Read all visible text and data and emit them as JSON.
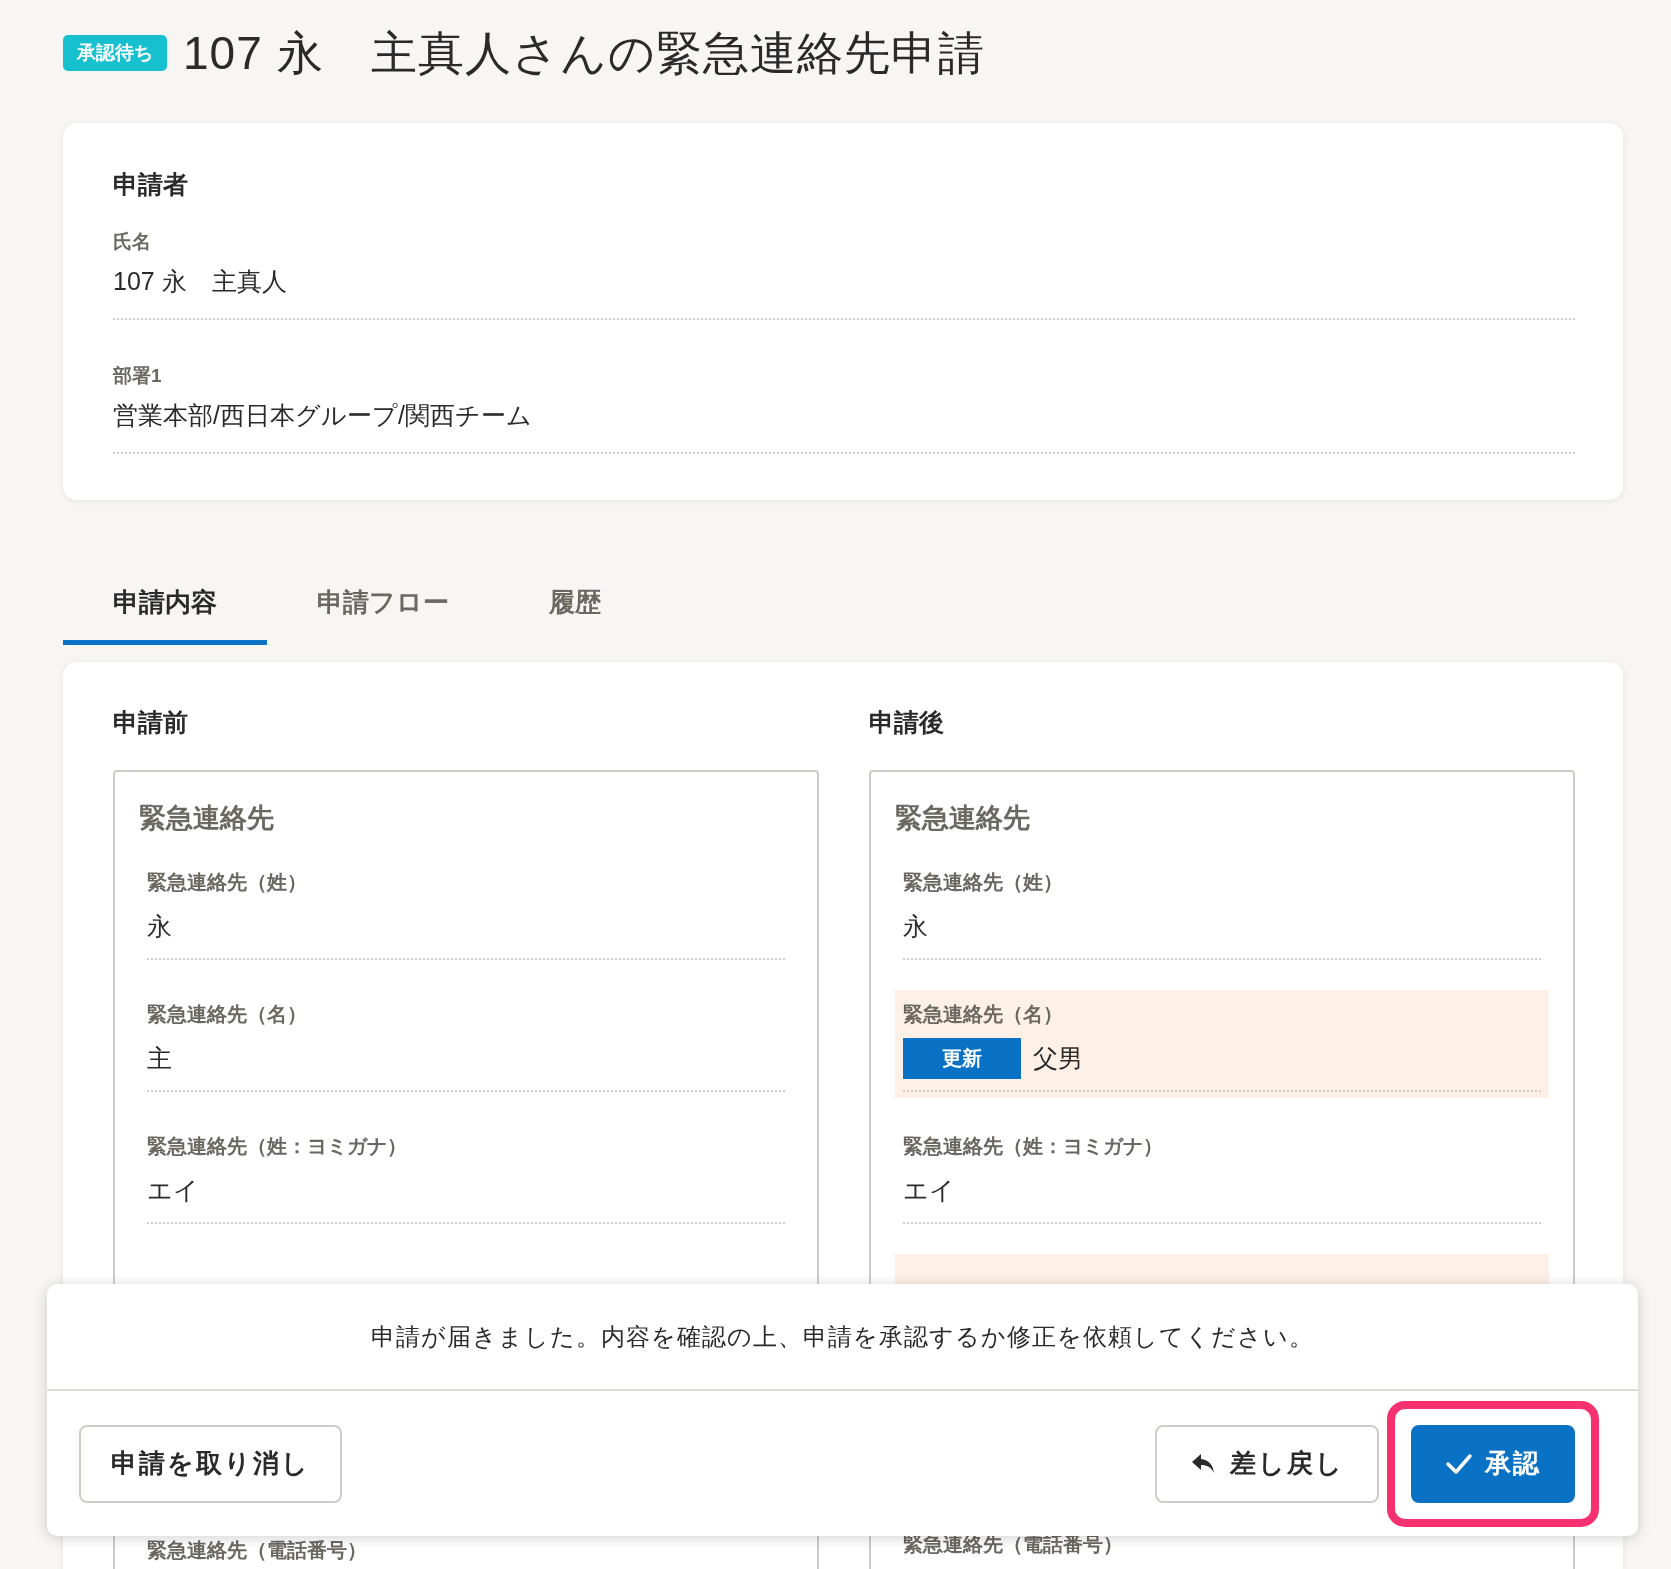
{
  "header": {
    "status_badge": "承認待ち",
    "title": "107 永　主真人さんの緊急連絡先申請"
  },
  "applicant": {
    "heading": "申請者",
    "fields": [
      {
        "label": "氏名",
        "value": "107 永　主真人"
      },
      {
        "label": "部署1",
        "value": "営業本部/西日本グループ/関西チーム"
      }
    ]
  },
  "tabs": [
    {
      "label": "申請内容",
      "selected": true
    },
    {
      "label": "申請フロー",
      "selected": false
    },
    {
      "label": "履歴",
      "selected": false
    }
  ],
  "comparison": {
    "columns": [
      {
        "heading": "申請前",
        "box_title": "緊急連絡先",
        "fields": [
          {
            "label": "緊急連絡先（姓）",
            "value": "永",
            "changed": false
          },
          {
            "label": "緊急連絡先（名）",
            "value": "主",
            "changed": false
          },
          {
            "label": "緊急連絡先（姓：ヨミガナ）",
            "value": "エイ",
            "changed": false
          },
          {
            "changed": false
          },
          {
            "label": "緊急連絡先（電話番号）",
            "changed": false
          }
        ]
      },
      {
        "heading": "申請後",
        "box_title": "緊急連絡先",
        "fields": [
          {
            "label": "緊急連絡先（姓）",
            "value": "永",
            "changed": false
          },
          {
            "label": "緊急連絡先（名）",
            "value": "父男",
            "changed": true,
            "badge": "更新"
          },
          {
            "label": "緊急連絡先（姓：ヨミガナ）",
            "value": "エイ",
            "changed": false
          },
          {
            "changed": true
          },
          {
            "label": "緊急連絡先（電話番号）",
            "changed": false
          }
        ]
      }
    ]
  },
  "dialog": {
    "message": "申請が届きました。内容を確認の上、申請を承認するか修正を依頼してください。",
    "buttons": [
      {
        "kind": "cancel",
        "label": "申請を取り消し",
        "highlighted": false
      },
      {
        "kind": "return",
        "label": "差し戻し",
        "highlighted": false
      },
      {
        "kind": "approve",
        "label": "承認",
        "highlighted": true
      }
    ]
  }
}
